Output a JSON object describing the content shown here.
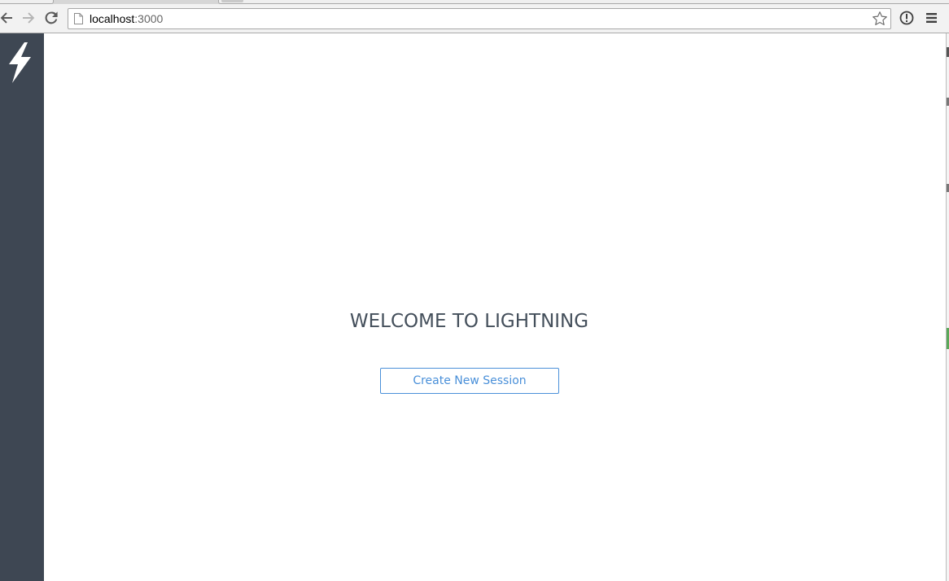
{
  "browser": {
    "url_host": "localhost",
    "url_port": ":3000",
    "icons": {
      "back": "back-arrow-icon",
      "forward": "forward-arrow-icon",
      "reload": "reload-icon",
      "page": "page-icon",
      "bookmark": "star-icon",
      "extension": "info-circle-icon",
      "menu": "hamburger-menu-icon"
    }
  },
  "sidebar": {
    "logo_icon": "lightning-bolt-icon",
    "background": "#3e4753"
  },
  "main": {
    "welcome_title": "WELCOME TO LIGHTNING",
    "create_session_label": "Create New Session",
    "accent_color": "#4a90d9",
    "title_color": "#444f5b"
  }
}
